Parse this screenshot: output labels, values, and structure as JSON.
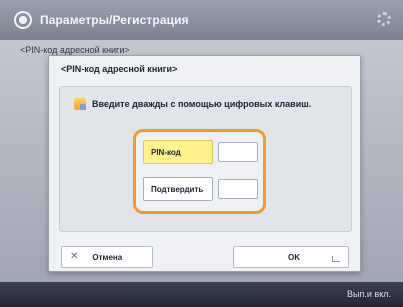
{
  "header": {
    "title": "Параметры/Регистрация"
  },
  "background": {
    "label": "<PIN-код адресной книги>",
    "ok_label": "OK"
  },
  "dialog": {
    "title": "<PIN-код адресной книги>",
    "instruction": "Введите дважды с помощью цифровых клавиш.",
    "pin_label": "PIN-код",
    "confirm_label": "Подтвердить",
    "pin_value": "",
    "confirm_value": "",
    "cancel_label": "Отмена",
    "ok_label": "OK"
  },
  "footer": {
    "status": "Вып.и вкл."
  },
  "colors": {
    "highlight": "#ee9b2f",
    "selected_field": "#fff28e"
  },
  "icons": [
    "settings-icon",
    "gear-icon",
    "info-icon",
    "close-icon",
    "enter-icon"
  ]
}
